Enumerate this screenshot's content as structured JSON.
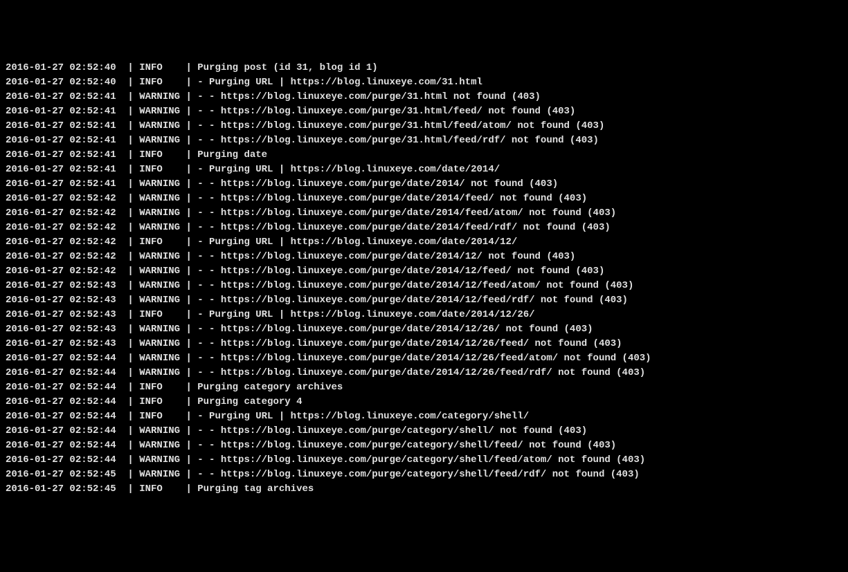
{
  "log_lines": [
    {
      "timestamp": "2016-01-27 02:52:40",
      "level": "INFO",
      "message": "Purging post (id 31, blog id 1)"
    },
    {
      "timestamp": "2016-01-27 02:52:40",
      "level": "INFO",
      "message": "- Purging URL | https://blog.linuxeye.com/31.html"
    },
    {
      "timestamp": "2016-01-27 02:52:41",
      "level": "WARNING",
      "message": "- - https://blog.linuxeye.com/purge/31.html not found (403)"
    },
    {
      "timestamp": "2016-01-27 02:52:41",
      "level": "WARNING",
      "message": "- - https://blog.linuxeye.com/purge/31.html/feed/ not found (403)"
    },
    {
      "timestamp": "2016-01-27 02:52:41",
      "level": "WARNING",
      "message": "- - https://blog.linuxeye.com/purge/31.html/feed/atom/ not found (403)"
    },
    {
      "timestamp": "2016-01-27 02:52:41",
      "level": "WARNING",
      "message": "- - https://blog.linuxeye.com/purge/31.html/feed/rdf/ not found (403)"
    },
    {
      "timestamp": "2016-01-27 02:52:41",
      "level": "INFO",
      "message": "Purging date"
    },
    {
      "timestamp": "2016-01-27 02:52:41",
      "level": "INFO",
      "message": "- Purging URL | https://blog.linuxeye.com/date/2014/"
    },
    {
      "timestamp": "2016-01-27 02:52:41",
      "level": "WARNING",
      "message": "- - https://blog.linuxeye.com/purge/date/2014/ not found (403)"
    },
    {
      "timestamp": "2016-01-27 02:52:42",
      "level": "WARNING",
      "message": "- - https://blog.linuxeye.com/purge/date/2014/feed/ not found (403)"
    },
    {
      "timestamp": "2016-01-27 02:52:42",
      "level": "WARNING",
      "message": "- - https://blog.linuxeye.com/purge/date/2014/feed/atom/ not found (403)"
    },
    {
      "timestamp": "2016-01-27 02:52:42",
      "level": "WARNING",
      "message": "- - https://blog.linuxeye.com/purge/date/2014/feed/rdf/ not found (403)"
    },
    {
      "timestamp": "2016-01-27 02:52:42",
      "level": "INFO",
      "message": "- Purging URL | https://blog.linuxeye.com/date/2014/12/"
    },
    {
      "timestamp": "2016-01-27 02:52:42",
      "level": "WARNING",
      "message": "- - https://blog.linuxeye.com/purge/date/2014/12/ not found (403)"
    },
    {
      "timestamp": "2016-01-27 02:52:42",
      "level": "WARNING",
      "message": "- - https://blog.linuxeye.com/purge/date/2014/12/feed/ not found (403)"
    },
    {
      "timestamp": "2016-01-27 02:52:43",
      "level": "WARNING",
      "message": "- - https://blog.linuxeye.com/purge/date/2014/12/feed/atom/ not found (403)"
    },
    {
      "timestamp": "2016-01-27 02:52:43",
      "level": "WARNING",
      "message": "- - https://blog.linuxeye.com/purge/date/2014/12/feed/rdf/ not found (403)"
    },
    {
      "timestamp": "2016-01-27 02:52:43",
      "level": "INFO",
      "message": "- Purging URL | https://blog.linuxeye.com/date/2014/12/26/"
    },
    {
      "timestamp": "2016-01-27 02:52:43",
      "level": "WARNING",
      "message": "- - https://blog.linuxeye.com/purge/date/2014/12/26/ not found (403)"
    },
    {
      "timestamp": "2016-01-27 02:52:43",
      "level": "WARNING",
      "message": "- - https://blog.linuxeye.com/purge/date/2014/12/26/feed/ not found (403)"
    },
    {
      "timestamp": "2016-01-27 02:52:44",
      "level": "WARNING",
      "message": "- - https://blog.linuxeye.com/purge/date/2014/12/26/feed/atom/ not found (403)"
    },
    {
      "timestamp": "2016-01-27 02:52:44",
      "level": "WARNING",
      "message": "- - https://blog.linuxeye.com/purge/date/2014/12/26/feed/rdf/ not found (403)"
    },
    {
      "timestamp": "2016-01-27 02:52:44",
      "level": "INFO",
      "message": "Purging category archives"
    },
    {
      "timestamp": "2016-01-27 02:52:44",
      "level": "INFO",
      "message": "Purging category 4"
    },
    {
      "timestamp": "2016-01-27 02:52:44",
      "level": "INFO",
      "message": "- Purging URL | https://blog.linuxeye.com/category/shell/"
    },
    {
      "timestamp": "2016-01-27 02:52:44",
      "level": "WARNING",
      "message": "- - https://blog.linuxeye.com/purge/category/shell/ not found (403)"
    },
    {
      "timestamp": "2016-01-27 02:52:44",
      "level": "WARNING",
      "message": "- - https://blog.linuxeye.com/purge/category/shell/feed/ not found (403)"
    },
    {
      "timestamp": "2016-01-27 02:52:44",
      "level": "WARNING",
      "message": "- - https://blog.linuxeye.com/purge/category/shell/feed/atom/ not found (403)"
    },
    {
      "timestamp": "2016-01-27 02:52:45",
      "level": "WARNING",
      "message": "- - https://blog.linuxeye.com/purge/category/shell/feed/rdf/ not found (403)"
    },
    {
      "timestamp": "2016-01-27 02:52:45",
      "level": "INFO",
      "message": "Purging tag archives"
    }
  ]
}
